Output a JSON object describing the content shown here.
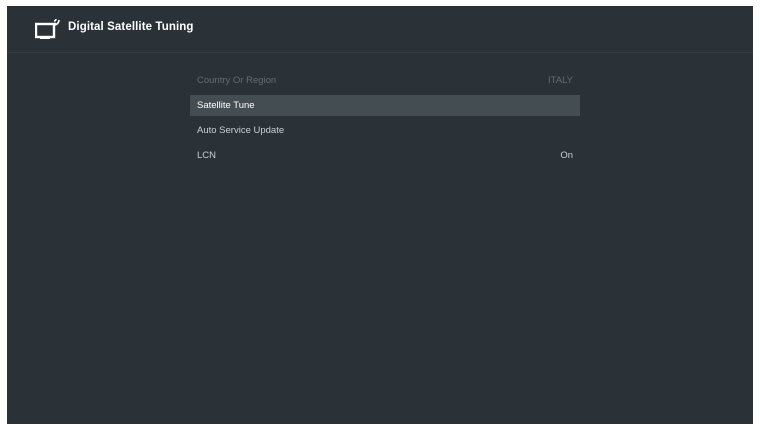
{
  "header": {
    "title": "Digital Satellite Tuning",
    "icon": "satellite-tv-icon"
  },
  "menu": {
    "items": [
      {
        "label": "Country Or Region",
        "value": "ITALY",
        "state": "disabled"
      },
      {
        "label": "Satellite Tune",
        "value": "",
        "state": "selected"
      },
      {
        "label": "Auto Service Update",
        "value": "",
        "state": "normal"
      },
      {
        "label": "LCN",
        "value": "On",
        "state": "normal"
      }
    ]
  },
  "colors": {
    "background": "#2a3237",
    "highlight": "#444d52",
    "text": "#ffffff",
    "disabled_text": "#646c70"
  }
}
